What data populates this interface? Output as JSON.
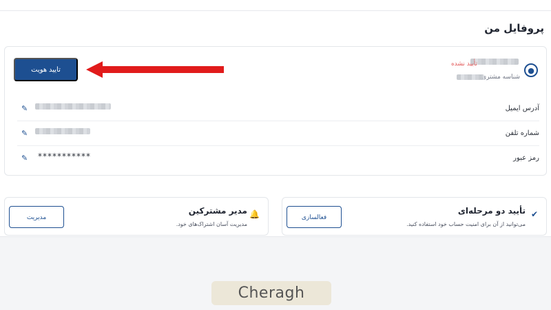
{
  "page": {
    "title": "پروفایل من"
  },
  "profile": {
    "verification_status": "تأیید نشده",
    "customer_id_label": "شناسه مشتری:",
    "verify_button": "تایید هویت",
    "fields": [
      {
        "label": "آدرس ایمیل",
        "value": ""
      },
      {
        "label": "شماره تلفن",
        "value": ""
      },
      {
        "label": "رمز عبور",
        "value": "***********"
      }
    ]
  },
  "features": {
    "two_factor": {
      "title": "تأیید دو مرحله‌ای",
      "description": "می‌توانید از آن برای امنیت حساب خود استفاده کنید.",
      "button": "فعالسازی",
      "icon": "shield-check-icon"
    },
    "subscriptions": {
      "title": "مدیر مشترکین",
      "description": "مدیریت آسان اشتراک‌های خود.",
      "button": "مدیریت",
      "icon": "bell-icon"
    }
  },
  "watermark": {
    "text": "Cheragh"
  },
  "colors": {
    "primary": "#1d4f91",
    "danger": "#e35d5d",
    "arrow": "#e11b1b"
  }
}
